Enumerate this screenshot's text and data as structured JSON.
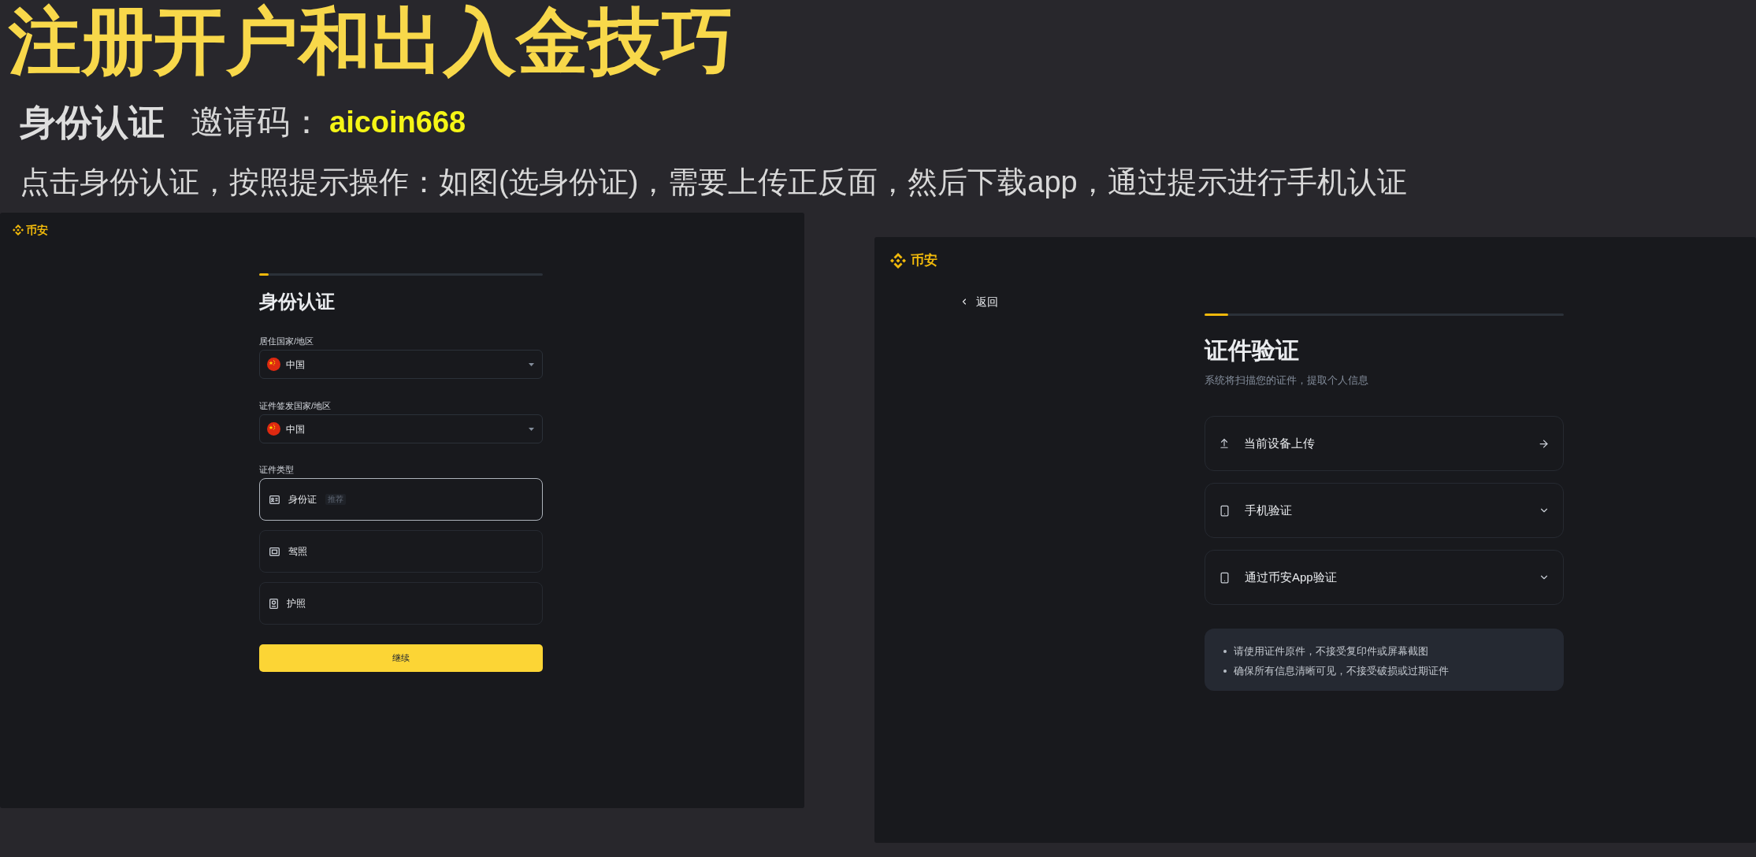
{
  "title": "注册开户和出入金技巧",
  "section": {
    "heading": "身份认证",
    "invite_label": "邀请码：",
    "invite_code": "aicoin668"
  },
  "instruction": "点击身份认证，按照提示操作：如图(选身份证)，需要上传正反面，然后下载app，通过提示进行手机认证",
  "screenshots": [
    {
      "kind": "identity_form",
      "brand": "币安",
      "progress": {
        "level": 0.033
      },
      "title": "身份认证",
      "fields": [
        {
          "label": "居住国家/地区",
          "value": "中国"
        },
        {
          "label": "证件签发国家/地区",
          "value": "中国"
        }
      ],
      "document_type": {
        "label": "证件类型",
        "options": [
          {
            "label": "身份证",
            "badge": "推荐",
            "selected": true
          },
          {
            "label": "驾照",
            "selected": false
          },
          {
            "label": "护照",
            "selected": false
          }
        ]
      },
      "button": "继续"
    },
    {
      "kind": "document_verification",
      "brand": "币安",
      "back": "返回",
      "progress": {
        "level": 0.066
      },
      "title": "证件验证",
      "subtitle": "系统将扫描您的证件，提取个人信息",
      "options": [
        {
          "kind": "link",
          "label": "当前设备上传"
        },
        {
          "kind": "accordion",
          "label": "手机验证",
          "expanded": false
        },
        {
          "kind": "accordion",
          "label": "通过币安App验证",
          "expanded": false
        }
      ],
      "notes": [
        "请使用证件原件，不接受复印件或屏幕截图",
        "确保所有信息清晰可见，不接受破损或过期证件"
      ]
    }
  ]
}
